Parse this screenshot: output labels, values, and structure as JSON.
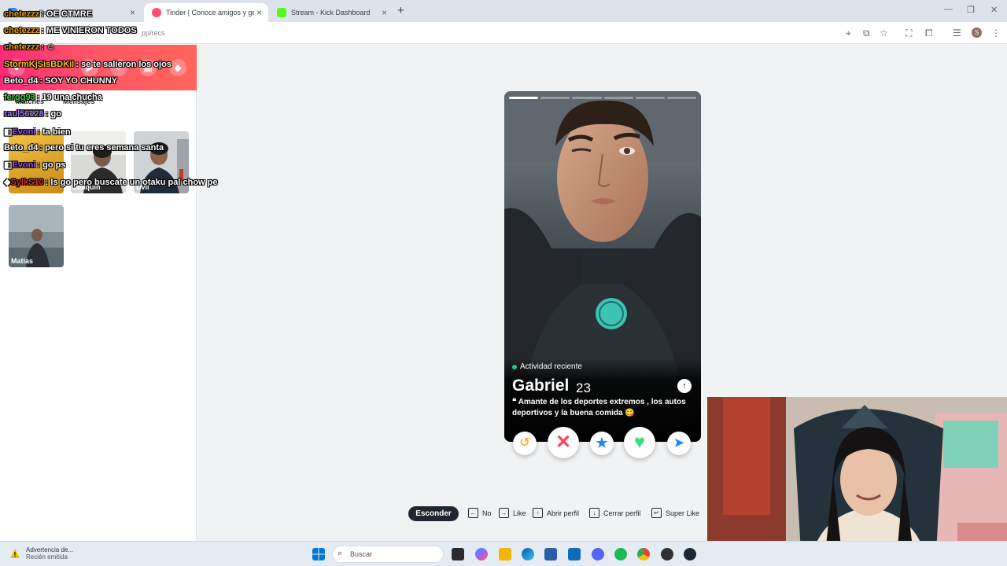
{
  "browser": {
    "tabs": [
      {
        "label": "... — Ru",
        "active": false
      },
      {
        "label": "Tinder | Conoce amigos y gente",
        "active": true
      },
      {
        "label": "Stream - Kick Dashboard",
        "active": false
      }
    ],
    "url": "pp/recs"
  },
  "sidebar": {
    "tabs": [
      "Matches",
      "Mensajes"
    ],
    "matches": [
      {
        "name": "",
        "photo": "match-1"
      },
      {
        "name": "Joaquin",
        "photo": "match-2"
      },
      {
        "name": "Dvil",
        "photo": "match-3"
      },
      {
        "name": "Matias",
        "photo": "match-4"
      }
    ]
  },
  "chat": [
    {
      "user": "chetezzz",
      "color": "#e0a000",
      "msg": "OE CTMRE"
    },
    {
      "user": "chetezzz",
      "color": "#e0a000",
      "msg": "ME VINIERON TODOS"
    },
    {
      "user": "chetezzz",
      "color": "#e0a000",
      "msg": ""
    },
    {
      "user": "StormKjSisBDKil",
      "color": "#f0c020",
      "msg": "se te salieron los ojos"
    },
    {
      "user": "Beto_d4",
      "color": "#ffffff",
      "msg": "SOY YO CHUNNY"
    },
    {
      "user": "fergg93",
      "color": "#4ecb40",
      "msg": "19 una chucha"
    },
    {
      "user": "raul56128",
      "color": "#9a7ce6",
      "msg": "go"
    },
    {
      "user": "Evoni",
      "color": "#9a4be6",
      "msg": "ta bien"
    },
    {
      "user": "Beto_d4",
      "color": "#ffffff",
      "msg": "pero si tu eres semana santa"
    },
    {
      "user": "Evoni",
      "color": "#9a4be6",
      "msg": "go ps"
    },
    {
      "user": "SylkS10",
      "color": "#d03030",
      "msg": "ls go pero buscate un otaku pal chow pe"
    }
  ],
  "profile": {
    "activity": "Actividad reciente",
    "name": "Gabriel",
    "age": "23",
    "bio": "Amante de los deportes extremos , los autos deportivos y la buena comida 😋",
    "photo_count": 6,
    "photo_index": 1
  },
  "actions": [
    {
      "name": "rewind",
      "icon": "rewind-icon",
      "color": "#f5b748"
    },
    {
      "name": "nope",
      "icon": "x-icon",
      "color": "#ff4458"
    },
    {
      "name": "super-like",
      "icon": "star-icon",
      "color": "#1786ff"
    },
    {
      "name": "like",
      "icon": "heart-icon",
      "color": "#3ddc84"
    },
    {
      "name": "boost",
      "icon": "send-icon",
      "color": "#1786ff"
    }
  ],
  "shortcuts": {
    "hide": "Esconder",
    "items": [
      {
        "key": "←",
        "label": "No"
      },
      {
        "key": "→",
        "label": "Like"
      },
      {
        "key": "↑",
        "label": "Abrir perfil"
      },
      {
        "key": "↓",
        "label": "Cerrar perfil"
      },
      {
        "key": "↵",
        "label": "Super Like"
      }
    ]
  },
  "taskbar": {
    "notification_title": "Advertencia de...",
    "notification_sub": "Recién emitida",
    "search_placeholder": "Buscar"
  }
}
